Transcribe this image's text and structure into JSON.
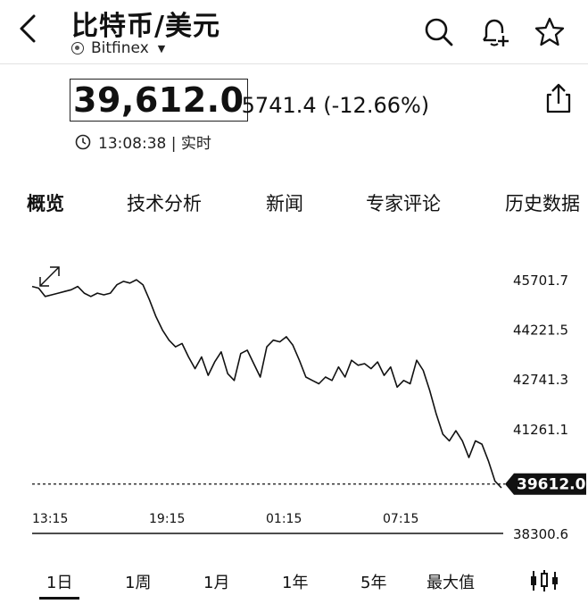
{
  "header": {
    "title": "比特币/美元",
    "source": "Bitfinex"
  },
  "quote": {
    "price": "39,612.0",
    "change": "-5741.4 (-12.66%)",
    "time": "13:08:38 | 实时"
  },
  "tabs": [
    {
      "label": "概览",
      "active": true
    },
    {
      "label": "技术分析",
      "active": false
    },
    {
      "label": "新闻",
      "active": false
    },
    {
      "label": "专家评论",
      "active": false
    },
    {
      "label": "历史数据",
      "active": false
    }
  ],
  "ranges": [
    {
      "label": "1日",
      "active": true
    },
    {
      "label": "1周",
      "active": false
    },
    {
      "label": "1月",
      "active": false
    },
    {
      "label": "1年",
      "active": false
    },
    {
      "label": "5年",
      "active": false
    },
    {
      "label": "最大值",
      "active": false
    }
  ],
  "icons": [
    "back-icon",
    "search-icon",
    "add-alert-icon",
    "star-icon",
    "share-icon",
    "clock-icon",
    "expand-icon",
    "candlestick-icon"
  ],
  "chart_data": {
    "type": "line",
    "x_ticks": [
      "13:15",
      "19:15",
      "01:15",
      "07:15"
    ],
    "y_ticks": [
      "45701.7",
      "44221.5",
      "42741.3",
      "41261.1",
      "38300.6"
    ],
    "last_price_label": "39612.0",
    "last_price": 39612.0,
    "ylim": [
      38300.6,
      46100
    ],
    "series": [
      {
        "values": [
          45500,
          45450,
          45200,
          45250,
          45300,
          45350,
          45400,
          45500,
          45300,
          45200,
          45300,
          45250,
          45300,
          45550,
          45650,
          45600,
          45700,
          45550,
          45100,
          44600,
          44200,
          43900,
          43700,
          43800,
          43400,
          43050,
          43400,
          42850,
          43250,
          43550,
          42900,
          42700,
          43500,
          43600,
          43200,
          42800,
          43700,
          43900,
          43850,
          44000,
          43750,
          43300,
          42800,
          42700,
          42600,
          42800,
          42700,
          43100,
          42800,
          43300,
          43150,
          43200,
          43050,
          43250,
          42850,
          43100,
          42500,
          42700,
          42600,
          43300,
          43000,
          42400,
          41700,
          41100,
          40900,
          41200,
          40900,
          40400,
          40900,
          40800,
          40300,
          39700,
          39500
        ]
      }
    ]
  }
}
